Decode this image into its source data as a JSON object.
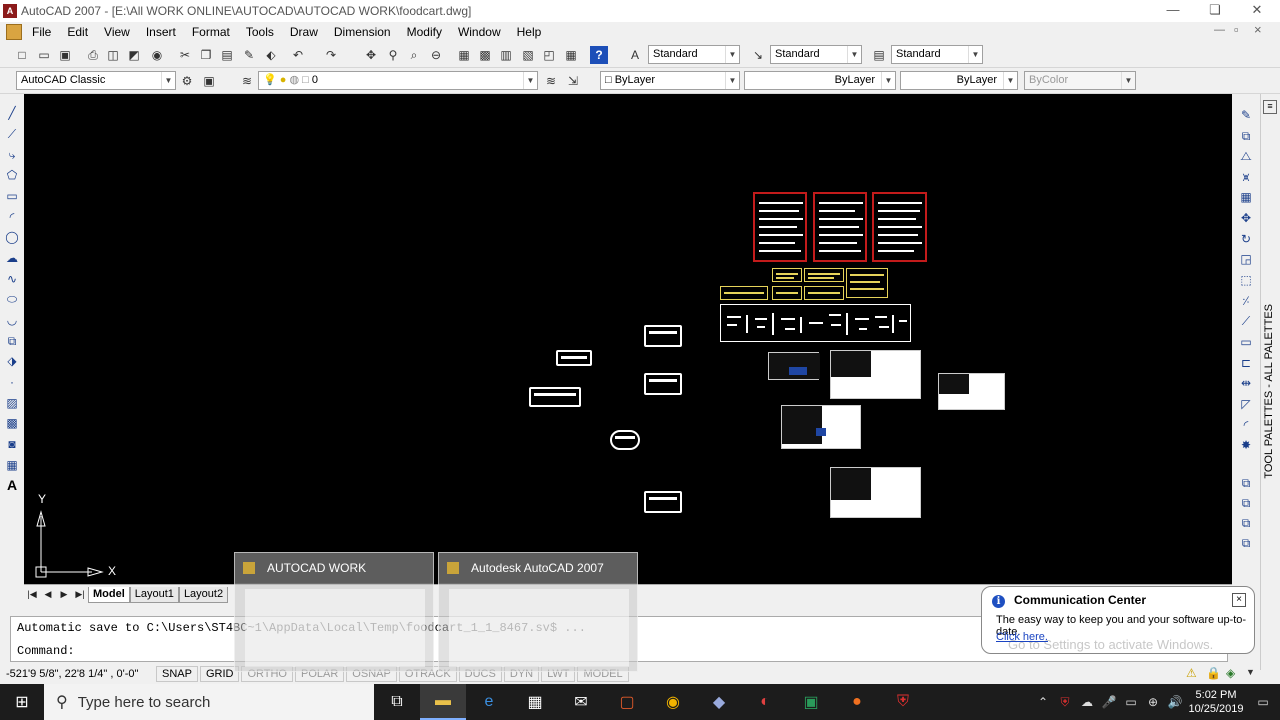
{
  "window": {
    "title": "AutoCAD 2007 - [E:\\All  WORK ONLINE\\AUTOCAD\\AUTOCAD WORK\\foodcart.dwg]",
    "minimize": "—",
    "restore": "❏",
    "close": "✕"
  },
  "menu": {
    "items": [
      "File",
      "Edit",
      "View",
      "Insert",
      "Format",
      "Tools",
      "Draw",
      "Dimension",
      "Modify",
      "Window",
      "Help"
    ],
    "doc_min": "—",
    "doc_restore": "▫",
    "doc_close": "×"
  },
  "styles_toolbar": {
    "text_style": "Standard",
    "dim_style": "Standard",
    "table_style": "Standard"
  },
  "workspace_toolbar": {
    "workspace": "AutoCAD Classic",
    "layer": "0",
    "color": "ByLayer",
    "linetype": "ByLayer",
    "lineweight": "ByLayer",
    "plotstyle": "ByColor"
  },
  "ucs": {
    "x_label": "X",
    "y_label": "Y"
  },
  "layout_tabs": {
    "tabs": [
      "Model",
      "Layout1",
      "Layout2"
    ],
    "active": "Model"
  },
  "command": {
    "line1": "Automatic save to C:\\Users\\ST4BC~1\\AppData\\Local\\Temp\\foodcart_1_1_8467.sv$ ...",
    "prompt": "Command:"
  },
  "status": {
    "coords": "-521'9 5/8\", 22'8 1/4\" , 0'-0\"",
    "buttons": [
      {
        "label": "SNAP",
        "on": true
      },
      {
        "label": "GRID",
        "on": true
      },
      {
        "label": "ORTHO",
        "on": false
      },
      {
        "label": "POLAR",
        "on": false
      },
      {
        "label": "OSNAP",
        "on": false
      },
      {
        "label": "OTRACK",
        "on": false
      },
      {
        "label": "DUCS",
        "on": false
      },
      {
        "label": "DYN",
        "on": false
      },
      {
        "label": "LWT",
        "on": false
      },
      {
        "label": "MODEL",
        "on": false
      }
    ]
  },
  "palette": {
    "label": "TOOL PALETTES - ALL PALETTES"
  },
  "taskbar_previews": [
    {
      "title": "AUTOCAD WORK"
    },
    {
      "title": "Autodesk AutoCAD 2007"
    }
  ],
  "notification": {
    "title": "Communication Center",
    "body": "The easy way to keep you and your software up-to-date.",
    "link": "Click here.",
    "watermark": "Go to Settings to activate Windows."
  },
  "taskbar": {
    "search_placeholder": "Type here to search",
    "time": "5:02 PM",
    "date": "10/25/2019"
  },
  "colors": {
    "canvas": "#000000",
    "sheet_border": "#c31b1b",
    "sheet_yellow": "#e6d35a",
    "taskbar": "#1c1c1c",
    "link": "#1a44c2"
  }
}
